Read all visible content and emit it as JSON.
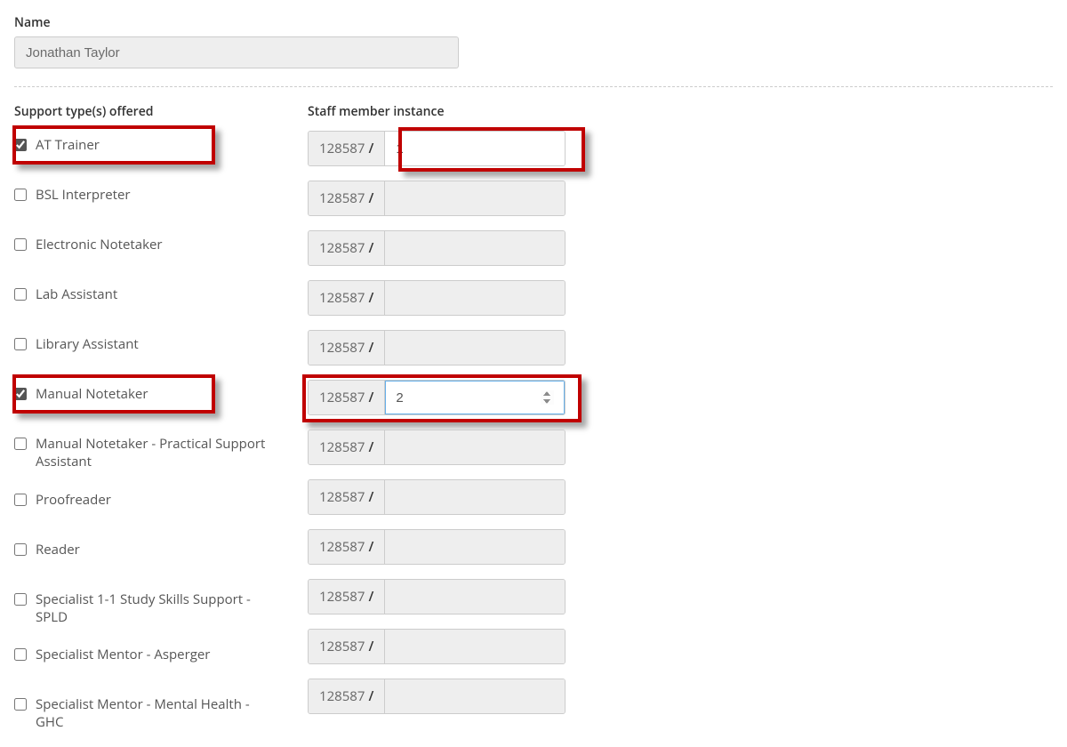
{
  "name": {
    "label": "Name",
    "value": "Jonathan Taylor"
  },
  "support_types_header": "Support type(s) offered",
  "staff_instance_header": "Staff member instance",
  "instance_prefix": "128587",
  "instance_separator": "/",
  "rows": [
    {
      "label": "AT Trainer",
      "checked": true,
      "instance_value": "1",
      "editable": true,
      "highlight_left": true,
      "highlight_right_small": true
    },
    {
      "label": "BSL Interpreter",
      "checked": false,
      "instance_value": "",
      "editable": false
    },
    {
      "label": "Electronic Notetaker",
      "checked": false,
      "instance_value": "",
      "editable": false
    },
    {
      "label": "Lab Assistant",
      "checked": false,
      "instance_value": "",
      "editable": false
    },
    {
      "label": "Library Assistant",
      "checked": false,
      "instance_value": "",
      "editable": false
    },
    {
      "label": "Manual Notetaker",
      "checked": true,
      "instance_value": "2",
      "editable": true,
      "focused": true,
      "highlight_left": true,
      "highlight_right_full": true
    },
    {
      "label": "Manual Notetaker - Practical Support Assistant",
      "checked": false,
      "instance_value": "",
      "editable": false
    },
    {
      "label": "Proofreader",
      "checked": false,
      "instance_value": "",
      "editable": false
    },
    {
      "label": "Reader",
      "checked": false,
      "instance_value": "",
      "editable": false
    },
    {
      "label": "Specialist 1-1 Study Skills Support - SPLD",
      "checked": false,
      "instance_value": "",
      "editable": false
    },
    {
      "label": "Specialist Mentor - Asperger",
      "checked": false,
      "instance_value": "",
      "editable": false
    },
    {
      "label": "Specialist Mentor - Mental Health - GHC",
      "checked": false,
      "instance_value": "",
      "editable": false
    }
  ]
}
